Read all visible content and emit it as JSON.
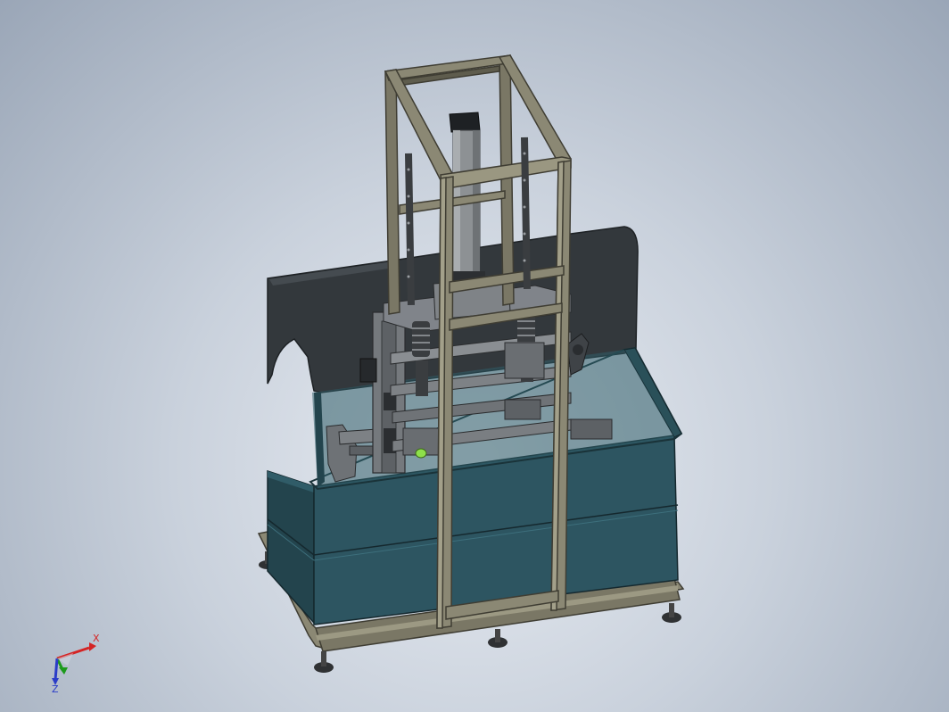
{
  "scene": {
    "model_name": "cad-machine-assembly",
    "colors": {
      "frame": "#8b8874",
      "frame_dark": "#5e5c4d",
      "tank": "#2d5561",
      "tank_dark": "#23444d",
      "panel": "#353a3e",
      "cylinder": "#8a8d8f",
      "mechanism": "#707478"
    }
  },
  "triad": {
    "x_label": "X",
    "y_label": "Y",
    "z_label": "Z",
    "x_color": "#d42424",
    "y_color": "#1c9a1c",
    "z_color": "#2a3cc8"
  }
}
